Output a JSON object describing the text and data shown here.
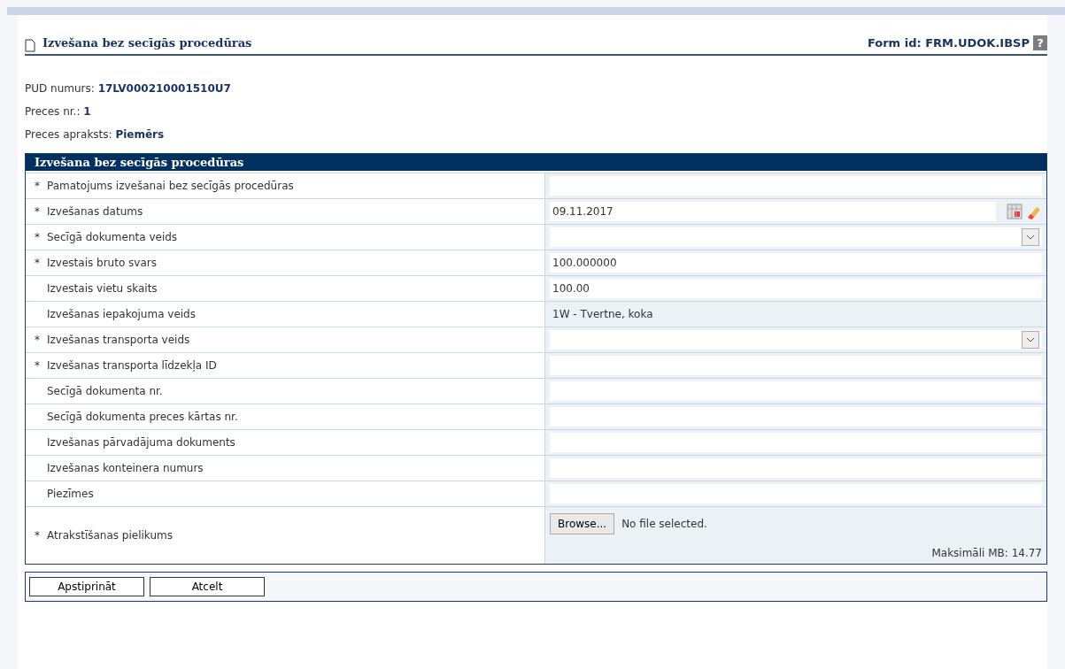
{
  "header": {
    "title": "Izvešana bez secīgās procedūras",
    "form_id": "Form id: FRM.UDOK.IBSP",
    "help_icon": "?"
  },
  "info": [
    {
      "label": "PUD numurs:",
      "value": "17LV000210001510U7"
    },
    {
      "label": "Preces nr.:",
      "value": "1"
    },
    {
      "label": "Preces apraksts:",
      "value": "Piemērs"
    }
  ],
  "section": {
    "title": "Izvešana bez secīgās procedūras",
    "rows": [
      {
        "mark": "*",
        "label": "Pamatojums izvešanai bez secīgās procedūras",
        "kind": "text"
      },
      {
        "mark": "*",
        "label": "Izvešanas datums",
        "kind": "date",
        "value": "09.11.2017"
      },
      {
        "mark": "*",
        "label": "Secīgā dokumenta veids",
        "kind": "select"
      },
      {
        "mark": "*",
        "label": "Izvestais bruto svars",
        "kind": "text",
        "value": "100.000000"
      },
      {
        "label": "Izvestais vietu skaits",
        "kind": "text",
        "value": "100.00"
      },
      {
        "label": "Izvešanas iepakojuma veids",
        "kind": "readonly",
        "value": "1W - Tvertne, koka"
      },
      {
        "mark": "*",
        "label": "Izvešanas transporta veids",
        "kind": "select"
      },
      {
        "mark": "*",
        "label": "Izvešanas transporta līdzekļa ID",
        "kind": "text"
      },
      {
        "label": "Secīgā dokumenta nr.",
        "kind": "text"
      },
      {
        "label": "Secīgā dokumenta preces kārtas nr.",
        "kind": "text"
      },
      {
        "label": "Izvešanas pārvadājuma dokuments",
        "kind": "text"
      },
      {
        "label": "Izvešanas konteinera numurs",
        "kind": "text"
      },
      {
        "label": "Piezīmes",
        "kind": "text"
      },
      {
        "mark": "*",
        "label": "Atrakstīšanas pielikums",
        "kind": "file",
        "button": "Browse...",
        "status": "No file selected.",
        "note": "Maksimāli MB: 14.77"
      }
    ]
  },
  "buttons": [
    "Apstiprināt",
    "Atcelt"
  ]
}
